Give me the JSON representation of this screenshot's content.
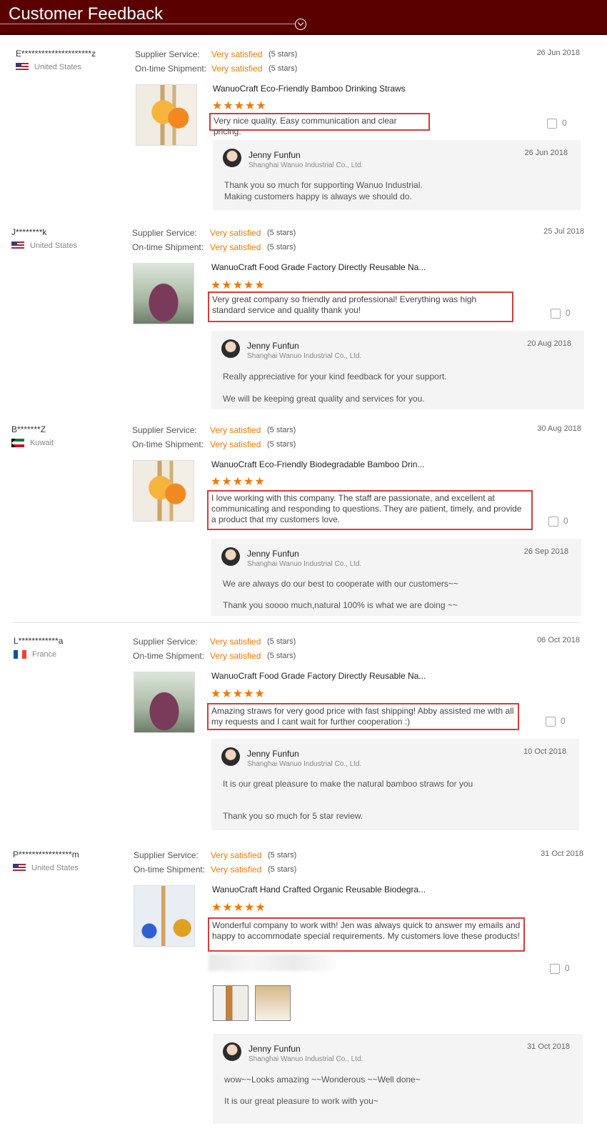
{
  "header": {
    "title": "Customer Feedback"
  },
  "labels": {
    "supplier": "Supplier Service:",
    "shipment": "On-time Shipment:",
    "satisfied": "Very satisfied",
    "stars": "(5 stars)",
    "stars_glyph": "★★★★★"
  },
  "reviews": [
    {
      "name": "E*********************z",
      "country": "United States",
      "flag": "us",
      "date": "26 Jun 2018",
      "product": "WanuoCraft Eco-Friendly Bamboo Drinking Straws",
      "comment": "Very nice quality. Easy communication and clear pricing.",
      "likes": "0",
      "reply": {
        "name": "Jenny Funfun",
        "company": "Shanghai Wanuo Industrial Co., Ltd.",
        "date": "26 Jun 2018",
        "lines": [
          "Thank you so much for supporting Wanuo Industrial.",
          "Making customers happy is always we should do."
        ]
      }
    },
    {
      "name": "J********k",
      "country": "United States",
      "flag": "us",
      "date": "25 Jul 2018",
      "product": "WanuoCraft Food Grade Factory Directly Reusable Na...",
      "comment": "Very great company so friendly and professional! Everything was high standard service and quality thank you!",
      "likes": "0",
      "reply": {
        "name": "Jenny Funfun",
        "company": "Shanghai Wanuo Industrial Co., Ltd.",
        "date": "20 Aug 2018",
        "lines": [
          "Really appreciative for your kind feedback for your support.",
          "We will be keeping great quality and services for you."
        ]
      }
    },
    {
      "name": "B*******Z",
      "country": "Kuwait",
      "flag": "kw",
      "date": "30 Aug 2018",
      "product": "WanuoCraft Eco-Friendly Biodegradable Bamboo Drin...",
      "comment": "I love working with this company. The staff are passionate, and excellent at communicating and responding to questions. They are patient, timely, and provide a product that my customers love.",
      "likes": "0",
      "reply": {
        "name": "Jenny Funfun",
        "company": "Shanghai Wanuo Industrial Co., Ltd.",
        "date": "26 Sep 2018",
        "lines": [
          "We are always do our best to cooperate with our customers~~",
          "Thank you soooo much,natural 100% is what we are doing ~~"
        ]
      }
    },
    {
      "name": "L************a",
      "country": "France",
      "flag": "fr",
      "date": "06 Oct 2018",
      "product": "WanuoCraft Food Grade Factory Directly Reusable Na...",
      "comment": "Amazing straws for very good price with fast shipping! Abby assisted me with all my requests and I cant wait for further cooperation :)",
      "likes": "0",
      "reply": {
        "name": "Jenny Funfun",
        "company": "Shanghai Wanuo Industrial Co., Ltd.",
        "date": "10 Oct 2018",
        "lines": [
          "It is our great pleasure to make the natural bamboo straws for you",
          "Thank you so much for 5 star review."
        ]
      }
    },
    {
      "name": "P****************m",
      "country": "United States",
      "flag": "us",
      "date": "31 Oct 2018",
      "product": "WanuoCraft Hand Crafted Organic Reusable Biodegra...",
      "comment": "Wonderful company to work with! Jen was always quick to answer my emails and happy to accommodate special requirements. My customers love these products!",
      "likes": "0",
      "reply": {
        "name": "Jenny Funfun",
        "company": "Shanghai Wanuo Industrial Co., Ltd.",
        "date": "31 Oct 2018",
        "lines": [
          "wow~~Looks amazing ~~Wonderous ~~Well done~",
          "It is our great pleasure to work with you~"
        ]
      }
    }
  ]
}
